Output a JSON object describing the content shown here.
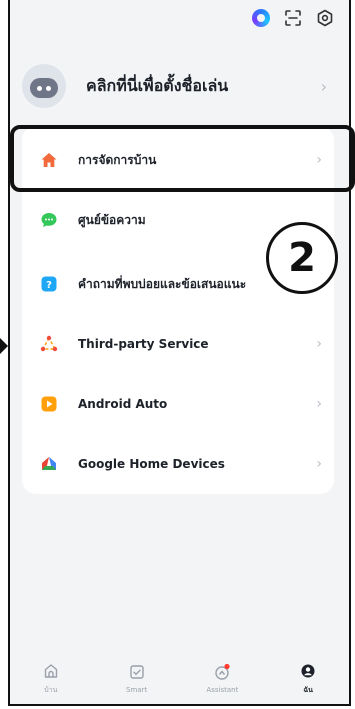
{
  "profile": {
    "name": "คลิกที่นี่เพื่อตั้งชื่อเล่น"
  },
  "menu": [
    {
      "label": "การจัดการบ้าน",
      "icon": "home-icon",
      "color": "#f06a3c"
    },
    {
      "label": "ศูนย์ข้อความ",
      "icon": "message-icon",
      "color": "#34c759"
    },
    {
      "label": "คำถามที่พบบ่อยและข้อเสนอแนะ",
      "icon": "help-icon",
      "color": "#1ea7f5"
    },
    {
      "label": "Third-party Service",
      "icon": "third-party-icon",
      "color": "#f04b3c"
    },
    {
      "label": "Android Auto",
      "icon": "android-auto-icon",
      "color": "#ff9f0a"
    },
    {
      "label": "Google Home Devices",
      "icon": "google-home-icon",
      "color": "#4285f4"
    }
  ],
  "annotation": {
    "step": "2"
  },
  "nav": [
    {
      "label": "บ้าน"
    },
    {
      "label": "Smart"
    },
    {
      "label": "Assistant"
    },
    {
      "label": "ฉัน"
    }
  ],
  "colors": {
    "accent_red": "#ff3b30",
    "text": "#1d2129",
    "muted": "#9aa0aa"
  }
}
